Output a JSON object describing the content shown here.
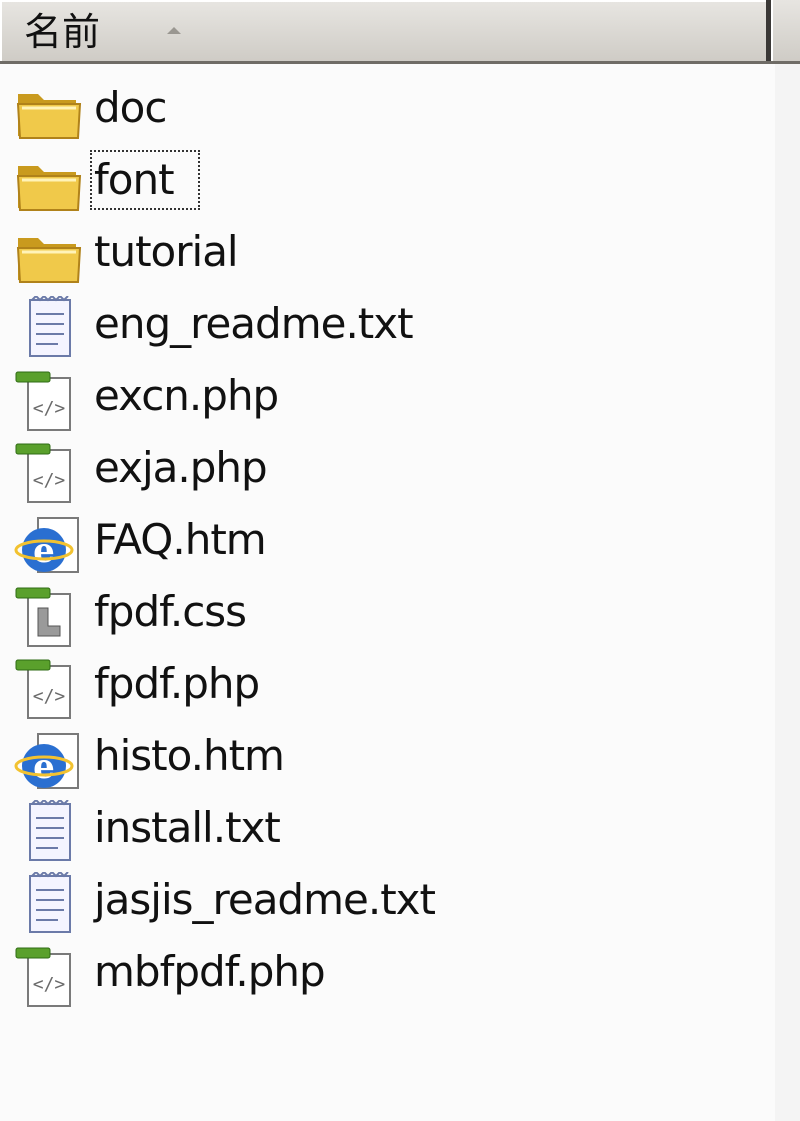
{
  "header": {
    "name_column": "名前"
  },
  "files": [
    {
      "name": "doc",
      "icon": "folder-icon"
    },
    {
      "name": "font",
      "icon": "folder-icon",
      "focused": true
    },
    {
      "name": "tutorial",
      "icon": "folder-icon"
    },
    {
      "name": "eng_readme.txt",
      "icon": "text-file-icon"
    },
    {
      "name": "excn.php",
      "icon": "php-file-icon"
    },
    {
      "name": "exja.php",
      "icon": "php-file-icon"
    },
    {
      "name": "FAQ.htm",
      "icon": "html-file-icon"
    },
    {
      "name": "fpdf.css",
      "icon": "css-file-icon"
    },
    {
      "name": "fpdf.php",
      "icon": "php-file-icon"
    },
    {
      "name": "histo.htm",
      "icon": "html-file-icon"
    },
    {
      "name": "install.txt",
      "icon": "text-file-icon"
    },
    {
      "name": "jasjis_readme.txt",
      "icon": "text-file-icon"
    },
    {
      "name": "mbfpdf.php",
      "icon": "php-file-icon"
    }
  ],
  "colors": {
    "folder": "#f0c94a",
    "folder_dark": "#c99a1e",
    "php_tab": "#5aa02c",
    "ie_blue": "#2a6fd1"
  }
}
